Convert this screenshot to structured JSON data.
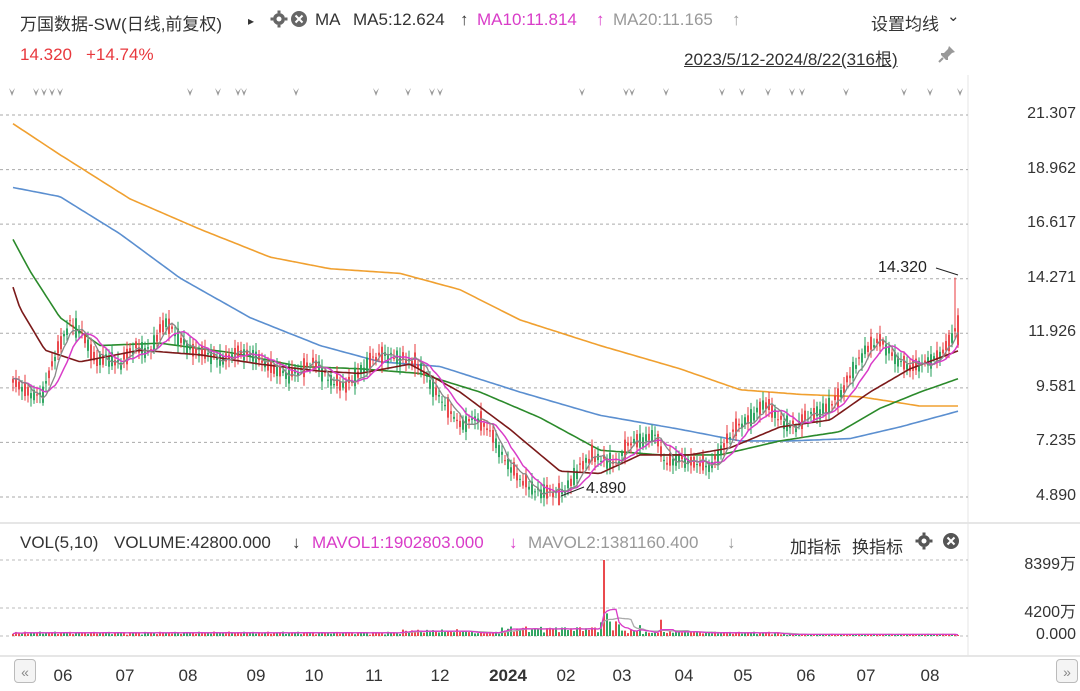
{
  "header": {
    "stock_name": "万国数据-SW(日线,前复权)",
    "expand_glyph": "▸",
    "gear_icon": "gear-icon",
    "close_icon": "close-icon",
    "indicator": "MA",
    "ma5": "MA5:12.624",
    "ma5_arrow": "↑",
    "ma10": "MA10:11.814",
    "ma10_arrow": "↑",
    "ma20": "MA20:11.165",
    "ma20_arrow": "↑",
    "settings_label": "设置均线",
    "settings_chevron": "⌄",
    "price": "14.320",
    "change_pct": "+14.74%",
    "range": "2023/5/12-2024/8/22(316根)",
    "pin_icon": "pin-icon"
  },
  "volume_header": {
    "label": "VOL(5,10)",
    "volume": "VOLUME:42800.000",
    "volume_arrow": "↓",
    "mavol1": "MAVOL1:1902803.000",
    "mavol1_arrow": "↓",
    "mavol2": "MAVOL2:1381160.400",
    "mavol2_arrow": "↓",
    "add_indicator": "加指标",
    "switch_indicator": "换指标"
  },
  "colors": {
    "up": "#e8383d",
    "down": "#1e9e54",
    "ma5": "#888888",
    "ma10": "#d93cc8",
    "ma20": "#7b1a1a",
    "ma60": "#2b8a2b",
    "ma120": "#5b8fd0",
    "ma250": "#f0a030"
  },
  "chart_data": [
    {
      "type": "candlestick",
      "title": "万国数据-SW(日线,前复权)",
      "y_ticks": [
        "21.307",
        "18.962",
        "16.617",
        "14.271",
        "11.926",
        "9.581",
        "7.235",
        "4.890"
      ],
      "ylim": [
        4.89,
        21.307
      ],
      "x_ticks": [
        "06",
        "07",
        "08",
        "09",
        "10",
        "11",
        "12",
        "2024",
        "02",
        "03",
        "04",
        "05",
        "06",
        "07",
        "08"
      ],
      "annotations": [
        {
          "label": "14.320",
          "meaning": "period high"
        },
        {
          "label": "4.890",
          "meaning": "period low"
        }
      ],
      "series": [
        {
          "name": "MA5",
          "last": 12.624
        },
        {
          "name": "MA10",
          "last": 11.814
        },
        {
          "name": "MA20",
          "last": 11.165
        }
      ],
      "grid": true
    },
    {
      "type": "bar",
      "title": "VOL(5,10)",
      "y_ticks": [
        "8399万",
        "4200万",
        "0.000"
      ],
      "ylim": [
        0,
        83990000
      ],
      "series": [
        {
          "name": "MAVOL1",
          "last": 1902803.0
        },
        {
          "name": "MAVOL2",
          "last": 1381160.4
        }
      ]
    }
  ],
  "scroll": {
    "left": "«",
    "right": "»"
  }
}
